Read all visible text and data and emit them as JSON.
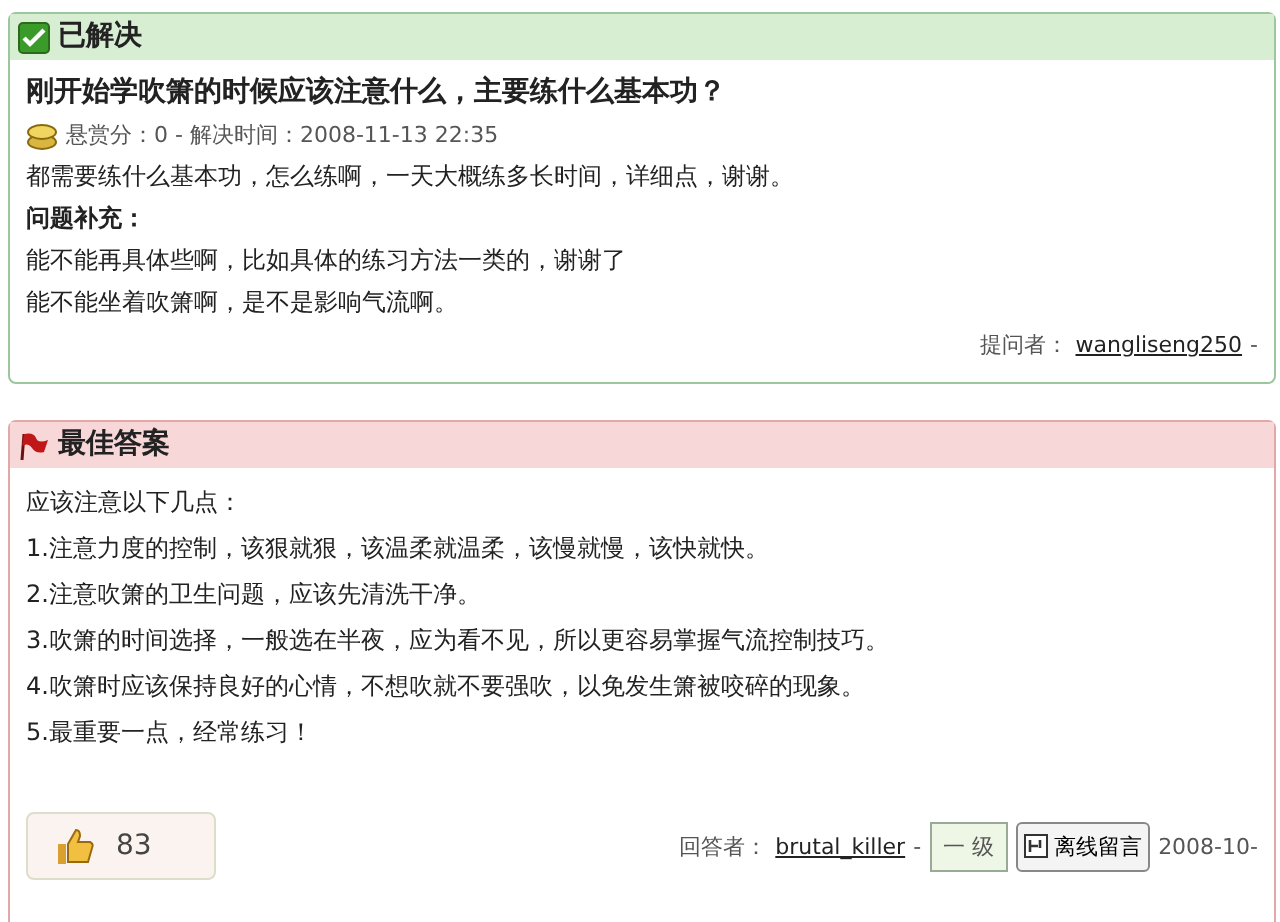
{
  "question": {
    "status": "已解决",
    "title": "刚开始学吹箫的时候应该注意什么，主要练什么基本功？",
    "meta": "悬赏分：0 - 解决时间：2008-11-13 22:35",
    "body": "都需要练什么基本功，怎么练啊，一天大概练多长时间，详细点，谢谢。",
    "supplement_label": "问题补充：",
    "supplement": [
      "能不能再具体些啊，比如具体的练习方法一类的，谢谢了",
      "能不能坐着吹箫啊，是不是影响气流啊。"
    ],
    "asker_label": "提问者：",
    "asker": "wangliseng250",
    "asker_sep": "-"
  },
  "answer": {
    "title": "最佳答案",
    "lines": [
      "应该注意以下几点：",
      "1.注意力度的控制，该狠就狠，该温柔就温柔，该慢就慢，该快就快。",
      "2.注意吹箫的卫生问题，应该先清洗干净。",
      "3.吹箫的时间选择，一般选在半夜，应为看不见，所以更容易掌握气流控制技巧。",
      "4.吹箫时应该保持良好的心情，不想吹就不要强吹，以免发生箫被咬碎的现象。",
      "5.最重要一点，经常练习！"
    ],
    "likes": "83",
    "answerer_label": "回答者：",
    "answerer": "brutal_killer",
    "answerer_sep": "-",
    "level": "一 级",
    "message_button": "离线留言",
    "date": "2008-10-"
  }
}
